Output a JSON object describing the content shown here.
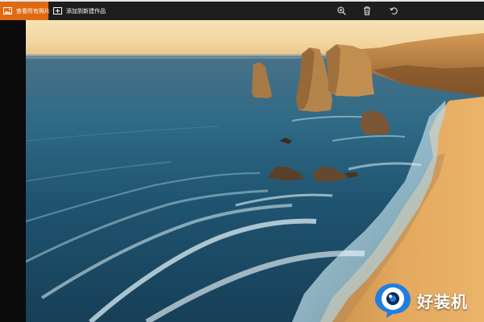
{
  "toolbar": {
    "view_all_photos_label": "查看所有照片",
    "add_to_creation_label": "添加到新建作品",
    "icons": [
      "zoom-in-icon",
      "delete-icon",
      "rotate-icon"
    ]
  },
  "photo": {
    "subject": "coastal sea stacks at sunset"
  },
  "watermark": {
    "text": "好装机",
    "logo_icon": "eye-logo"
  },
  "colors": {
    "accent": "#e06a12",
    "toolbar_bg": "#1e1e1e",
    "logo_blue": "#1f7fe0"
  }
}
